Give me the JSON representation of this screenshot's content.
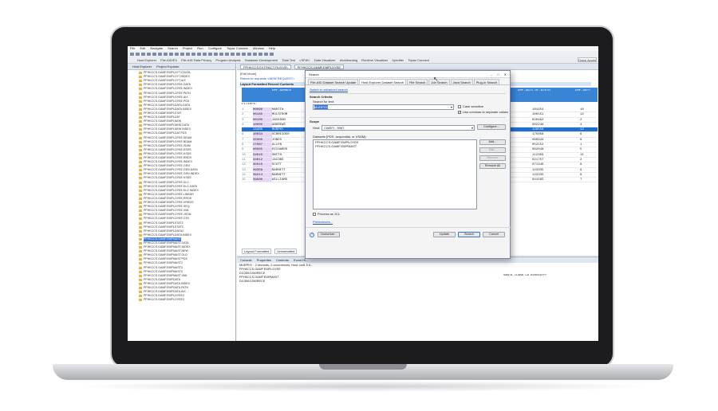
{
  "menu": [
    "File",
    "Edit",
    "Navigate",
    "Search",
    "Project",
    "Run",
    "Configure",
    "Topaz Connect",
    "Window",
    "Help"
  ],
  "perspectives": [
    "Host Explorer",
    "File-AID/EX",
    "File-AID Data Privacy",
    "Program Analysis",
    "Database Development",
    "Total Test",
    "<SFW>",
    "Data Visualizer",
    "Workframing",
    "Runtime Visualizer",
    "Xpediter",
    "Topaz Connect"
  ],
  "quick_access": "Quick Access",
  "left_tabs": [
    "Host Explorer",
    "Project Explorer"
  ],
  "tree_items": [
    "PFHKCCS.GAMF.EMPLOYT.CDATA",
    "PFHKCCS.GAMF.EMPLOYT.INDEX",
    "PFHKCCS.GAMF.EMPLOYT.AIX",
    "PFHKCCS.GAMF.EMPLOYEE.DATA",
    "PFHKCCS.GAMF.EMPLOYEE.INDEX",
    "PFHKCCS.GAMF.EMPLOYEE.PATH",
    "PFHKCCS.GAMF.EMPLOYEE.AIX",
    "PFHKCCS.GAMF.EMPLOYEE.PDS",
    "PFHKCCS.GAMF.EMPLDATA.DATA",
    "PFHKCCS.GAMF.EMPLDATA.INDEX",
    "PFHKCCS.GAMF.EMPLSTAT",
    "PFHKCCS.GAMF.EMPLDAT",
    "PFHKCCS.GAMF.EMPLNEW",
    "PFHKCCS.GAMF.EMPLNEW.DATA",
    "PFHKCCS.GAMF.EMPLNEW.INDEX",
    "PFHKCCS.GAMF.EMPLDAT.PDS",
    "PFHKCCS.GAMF.EMPLOYEE.SEAM",
    "PFHKCCS.GAMF.EMPLOYEE.BDAM",
    "PFHKCCS.GAMF.EMPLOYEE.ISAM",
    "PFHKCCS.GAMF.EMPLOYEE.ESDS",
    "PFHKCCS.GAMF.EMPLOYEE.KSDS",
    "PFHKCCS.GAMF.EMPLOYEE.RRDS",
    "PFHKCCS.GAMF.EMPLOYEE.INDEX",
    "PFHKCCS.GAMF.EMPLOYEE.GEN",
    "PFHKCCS.GAMF.EMPLOYEE.GEN.DATA",
    "PFHKCCS.GAMF.EMPLOYEE.GEN.INDEX",
    "PFHKCCS.GAMF.EMPLOYEE.KSDS",
    "PFHKCCS.GAMF.EMPLOYEE.KLC",
    "PFHKCCS.GAMF.EMPLOYEE.KLC.DATA",
    "PFHKCCS.GAMF.EMPLOYEE.KLC.INDEX",
    "PFHKCCS.GAMF.EMPLOYEE.LINEAR",
    "PFHKCCS.GAMF.EMPLOYEE.RRDS",
    "PFHKCCS.GAMF.EMPLOYEE.VRRDS",
    "PFHKCCS.GAMF.EMPLOYEE.SEQ",
    "PFHKCCS.GAMF.EMPLOYEE.XML",
    "PFHKCCS.GAMF.EMPLOYEE.JSON",
    "PFHKCCS.GAMF.EMPLOYEE.CSV",
    "PFHKCCS.GAMF.EMPLSTAT2",
    "PFHKCCS.GAMF.EMPLSTAT3",
    "PFHKCCS.GAMF.EMPLDATA2",
    "PFHKCCS.GAMF.EMPLDATA.INDEX",
    "PFHKCCS.GAMF.EMPMAST",
    "PFHKCCS.GAMF.EMPMAST.DATA",
    "PFHKCCS.GAMF.EMPMAST.INDEX",
    "PFHKCCS.GAMF.EMPMAST.NEW",
    "PFHKCCS.GAMF.EMPMAST.OLD",
    "PFHKCCS.GAMF.EMPMAST.PDS",
    "PFHKCCS.GAMF.EMPMAST2",
    "PFHKCCS.GAMF.EMPMAST3",
    "PFHKCCS.GAMF.EMPMASTX",
    "PFHKCCS.GAMF.EMPMAST.XML",
    "PFHKCCS.GAMF.EMPDATA",
    "PFHKCCS.GAMF.EMPDATA.INDEX",
    "PFHKCCS.GAMF.EMPDATA.PATH",
    "PFHKCCS.GAMF.EMPDATA.AIX",
    "PFHKCCS.GAMF.EMPLOYEE2",
    "PFHKCCS.GAMF.EMPLOYEE3"
  ],
  "selected_tree_index": 41,
  "editor": {
    "tabs": [
      "PFHKCCS.EXTRACT.FILE(V5)",
      "PFHKCCS.GAMF.EMPLOYEE"
    ],
    "mode": "[Edit Mode]",
    "return_link": "Return to requests <NEW REQUEST>",
    "layout_caption": "Layout Formatted Record Contents",
    "filters_label": "Filters:",
    "headers": [
      "EMP-NUMBER",
      "EMP-LAST-NAME",
      "EMP-DATE-OF-BIRTH",
      "EMP-DEPT"
    ],
    "rows": [
      [
        "1",
        "00090",
        "MARTIN",
        "",
        "181954",
        "10"
      ],
      [
        "2",
        "00180",
        "MULSTROM",
        "",
        "100151",
        "12"
      ],
      [
        "3",
        "00100",
        "JACKSON",
        "",
        "820462",
        "2"
      ],
      [
        "4",
        "10000",
        "ANDREWS",
        "",
        "062248",
        "4"
      ],
      [
        "5",
        "13400",
        "MURPHY",
        "",
        "126559",
        "12"
      ],
      [
        "6",
        "10034",
        "SCHREIDER",
        "",
        "175058",
        "6"
      ],
      [
        "7",
        "25300",
        "JONES",
        "",
        "090944",
        "9"
      ],
      [
        "8",
        "27087",
        "ALLEN",
        "",
        "052152",
        "1"
      ],
      [
        "9",
        "00005",
        "RICHARDS",
        "",
        "082048",
        "5"
      ],
      [
        "10",
        "34010",
        "SMITH",
        "",
        "112359",
        "11"
      ],
      [
        "11",
        "34012",
        "JACOBS",
        "",
        "021757",
        "2"
      ],
      [
        "12",
        "35010",
        "SCOTT",
        "",
        "071346",
        "8"
      ],
      [
        "13",
        "39358",
        "BARNETT",
        "",
        "123335",
        "9"
      ],
      [
        "14",
        "39314",
        "BARNETT",
        "",
        "123335",
        "9"
      ],
      [
        "15",
        "39500",
        "WILLIAMS",
        "",
        "041565",
        "7"
      ]
    ],
    "highlight_row": 4,
    "bottom_tabs": [
      "Layout Formatted",
      "Unformatted"
    ]
  },
  "console": {
    "tabs": [
      "Console",
      "Properties",
      "Contents",
      "Event Hi..."
    ],
    "lines": [
      "MURPHY - 2 seconds, 2 occurrences; Host: cwl1 5 #...",
      "PFHKCCS.GAMF.EMPLOYEE",
      "  D/1350/1350RECE",
      "PFHKCCS.GAMF.EMPMAST",
      "  D/1350/1350RECE"
    ],
    "right_text": "SANTA CLARA   CA  95050ZFFF"
  },
  "dialog": {
    "title": "Search",
    "tabs": [
      "File-AID Dataset Search Update",
      "Host Explorer Dataset Search",
      "File Search",
      "Job Search",
      "Java Search",
      "Plug-in Search"
    ],
    "switch_link": "Switch to advanced search",
    "criteria_header": "Search Criteria",
    "search_for_label": "Search for text:",
    "search_text": "MURPHY",
    "case_sensitive": "Case sensitive",
    "use_commas": "Use commas to separate values",
    "scope_header": "Scope",
    "host_label": "Host:",
    "host_value": "CWEFI - 5967",
    "configure_btn": "Configure...",
    "datasets_label": "Datasets (PDS, sequential, or VSAM):",
    "datasets": [
      "PFHKCCS.GAMF.EMPLOYEE",
      "PFHKCCS.GAMF.EMPMAST"
    ],
    "add_btn": "Add...",
    "edit_btn": "Edit...",
    "remove_btn": "Remove",
    "remove_all_btn": "Remove All",
    "process_jcl": "Process as JCL",
    "preferences_link": "Preferences...",
    "help": "?",
    "customize_btn": "Customize...",
    "update_btn": "Update",
    "search_btn": "Search",
    "cancel_btn": "Cancel"
  }
}
